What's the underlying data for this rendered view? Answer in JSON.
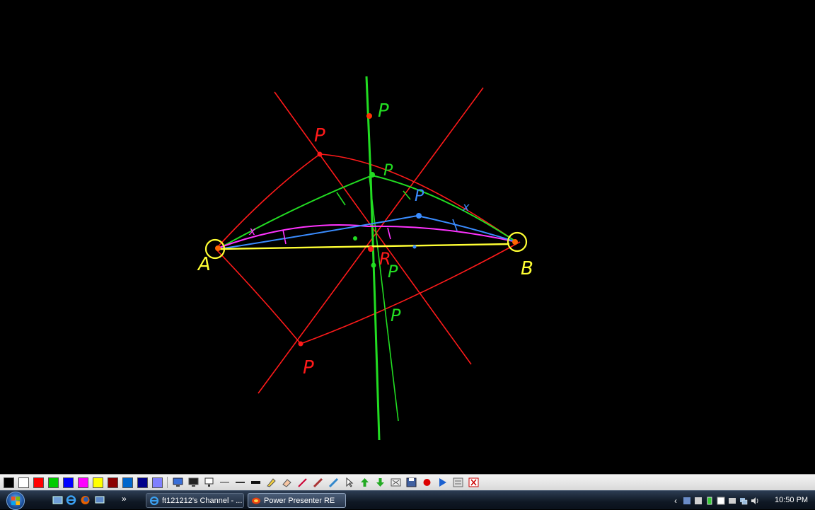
{
  "canvas": {
    "labels": {
      "p": "P",
      "r": "R",
      "a": "A",
      "b": "B",
      "x": "x"
    }
  },
  "toolbar": {
    "colors": [
      "#000000",
      "#ffffff",
      "#ff0000",
      "#00cc00",
      "#0000ff",
      "#ff00ff",
      "#ffff00",
      "#8b0000",
      "#0066cc",
      "#00008b",
      "#8080ff"
    ]
  },
  "taskbar": {
    "quicklaunch_more": "»",
    "tasks": [
      {
        "label": "ft121212's Channel - ...",
        "active": false
      },
      {
        "label": "Power Presenter RE",
        "active": true
      }
    ],
    "tray_chevron": "‹",
    "clock": "10:50 PM"
  }
}
